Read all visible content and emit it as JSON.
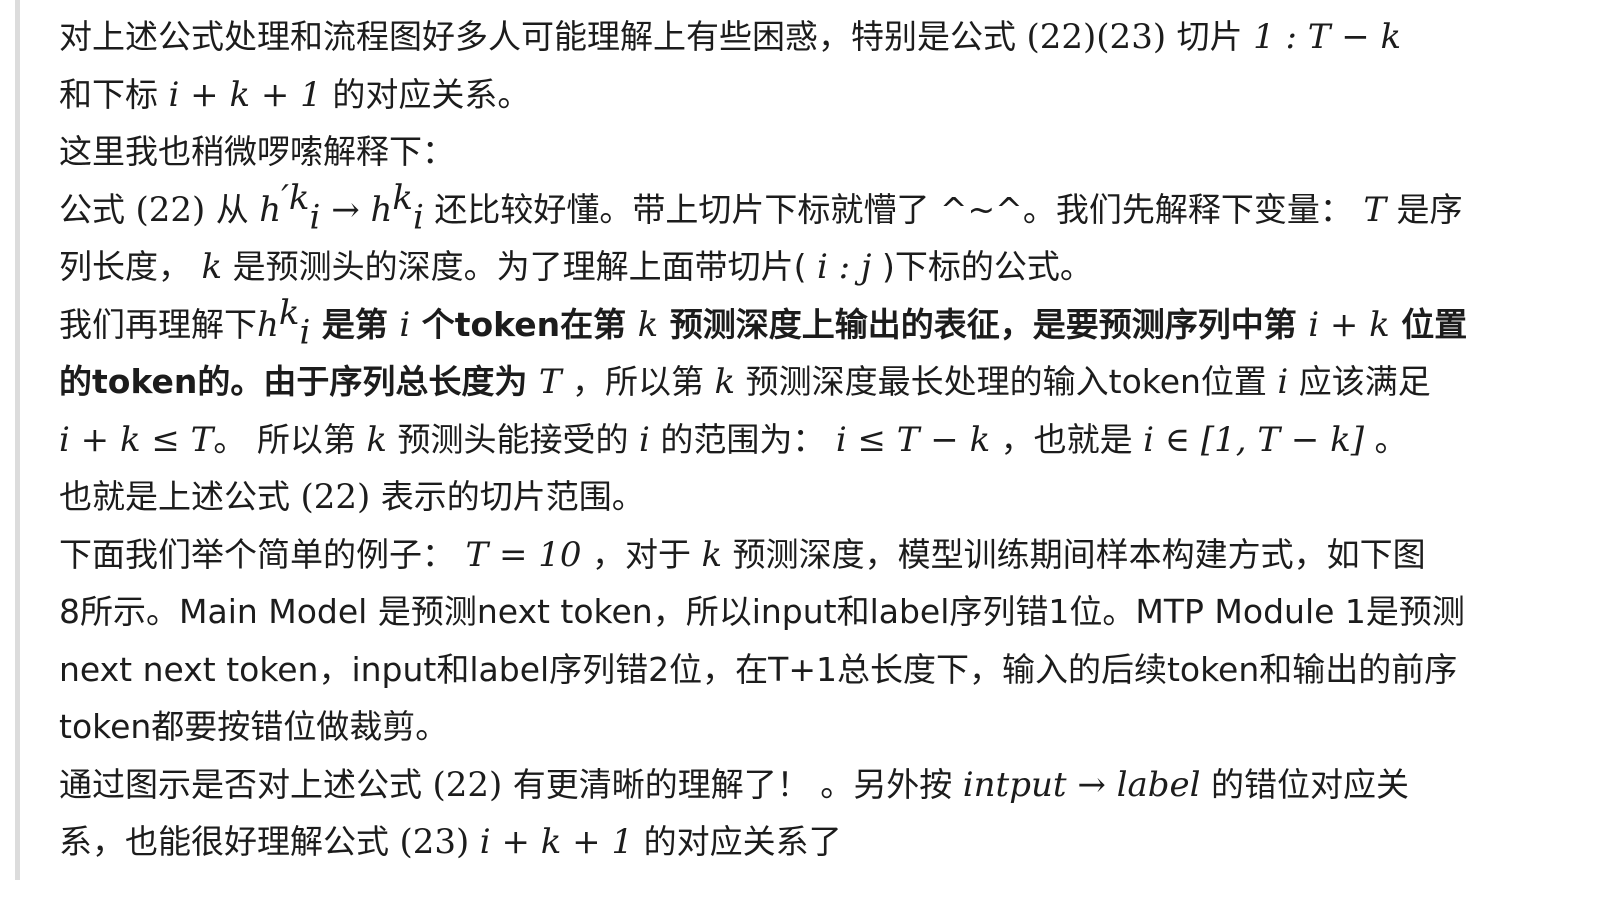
{
  "blockquote": {
    "lines": [
      [
        {
          "t": "对上述公式处理和流程图好多人可能理解上有些困惑，特别是公式 "
        },
        {
          "t": "(22)(23)",
          "m": true,
          "up": true
        },
        {
          "t": " 切片 "
        },
        {
          "t": "1 : T − k",
          "m": true
        }
      ],
      [
        {
          "t": "和下标 "
        },
        {
          "t": "i + k + 1",
          "m": true
        },
        {
          "t": " 的对应关系。"
        }
      ],
      [
        {
          "t": "这里我也稍微啰嗦解释下："
        }
      ],
      [
        {
          "t": "公式 "
        },
        {
          "t": "(22)",
          "m": true,
          "up": true
        },
        {
          "t": " 从 "
        },
        {
          "t": "h",
          "m": true
        },
        {
          "t": "′k",
          "sup": true,
          "m": true
        },
        {
          "t": "i",
          "sub": true,
          "m": true
        },
        {
          "t": " → h",
          "m": true
        },
        {
          "t": "k",
          "sup": true,
          "m": true
        },
        {
          "t": "i",
          "sub": true,
          "m": true
        },
        {
          "t": " 还比较好懂。带上切片下标就懵了 ^~^。我们先解释下变量： "
        },
        {
          "t": "T",
          "m": true
        },
        {
          "t": " 是序"
        }
      ],
      [
        {
          "t": "列长度， "
        },
        {
          "t": "k",
          "m": true
        },
        {
          "t": " 是预测头的深度。为了理解上面带切片( "
        },
        {
          "t": "i : j",
          "m": true
        },
        {
          "t": " )下标的公式。"
        }
      ],
      [
        {
          "t": "我们再理解下"
        },
        {
          "t": "h",
          "m": true
        },
        {
          "t": "k",
          "sup": true,
          "m": true
        },
        {
          "t": "i",
          "sub": true,
          "m": true
        },
        {
          "t": " 是第 ",
          "b": true
        },
        {
          "t": "i",
          "m": true
        },
        {
          "t": " 个token在第 ",
          "b": true
        },
        {
          "t": "k",
          "m": true
        },
        {
          "t": " 预测深度上输出的表征，是要预测序列中第 ",
          "b": true
        },
        {
          "t": "i + k",
          "m": true
        },
        {
          "t": " 位置",
          "b": true
        }
      ],
      [
        {
          "t": "的token的。由于序列总长度为 ",
          "b": true
        },
        {
          "t": "T",
          "m": true
        },
        {
          "t": " ，所以第 "
        },
        {
          "t": "k",
          "m": true
        },
        {
          "t": " 预测深度最长处理的输入token位置 "
        },
        {
          "t": "i",
          "m": true
        },
        {
          "t": " 应该满足"
        }
      ],
      [
        {
          "t": "i + k ≤ T",
          "m": true
        },
        {
          "t": "。 所以第 "
        },
        {
          "t": "k",
          "m": true
        },
        {
          "t": " 预测头能接受的 "
        },
        {
          "t": "i",
          "m": true
        },
        {
          "t": " 的范围为： "
        },
        {
          "t": "i ≤ T − k",
          "m": true
        },
        {
          "t": " ，也就是 "
        },
        {
          "t": "i ∈ [1, T − k]",
          "m": true
        },
        {
          "t": " 。"
        }
      ],
      [
        {
          "t": "也就是上述公式 "
        },
        {
          "t": "(22)",
          "m": true,
          "up": true
        },
        {
          "t": " 表示的切片范围。"
        }
      ],
      [
        {
          "t": "下面我们举个简单的例子： "
        },
        {
          "t": "T = 10",
          "m": true
        },
        {
          "t": " ，对于 "
        },
        {
          "t": "k",
          "m": true
        },
        {
          "t": " 预测深度，模型训练期间样本构建方式，如下图"
        }
      ],
      [
        {
          "t": "8所示。Main Model 是预测next token，所以input和label序列错1位。MTP Module 1是预测"
        }
      ],
      [
        {
          "t": "next next token，input和label序列错2位，在T+1总长度下，输入的后续token和输出的前序"
        }
      ],
      [
        {
          "t": "token都要按错位做裁剪。"
        }
      ],
      [
        {
          "t": "通过图示是否对上述公式 "
        },
        {
          "t": "(22)",
          "m": true,
          "up": true
        },
        {
          "t": " 有更清晰的理解了！ 。另外按 "
        },
        {
          "t": "intput → label",
          "m": true
        },
        {
          "t": " 的错位对应关"
        }
      ],
      [
        {
          "t": "系，也能很好理解公式 "
        },
        {
          "t": "(23)",
          "m": true,
          "up": true
        },
        {
          "t": " "
        },
        {
          "t": "i + k + 1",
          "m": true
        },
        {
          "t": " 的对应关系了"
        }
      ]
    ]
  }
}
